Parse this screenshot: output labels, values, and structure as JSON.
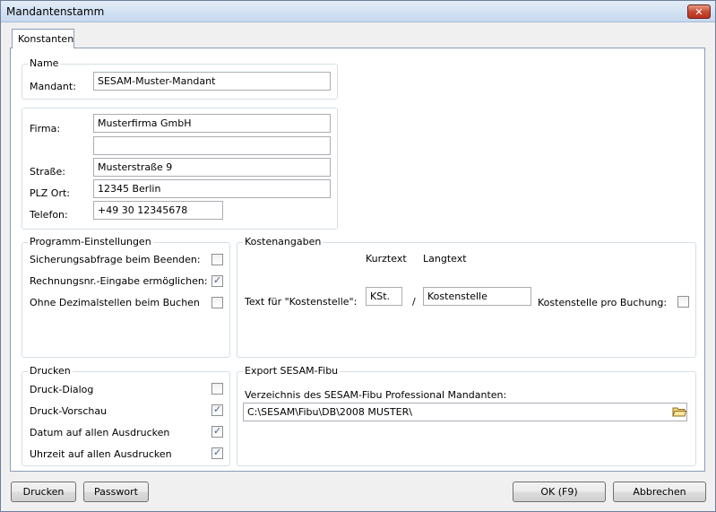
{
  "window": {
    "title": "Mandantenstamm"
  },
  "tabs": [
    {
      "label": "Konstanten"
    }
  ],
  "name_group": {
    "title": "Name",
    "mandant_label": "Mandant:",
    "mandant_value": "SESAM-Muster-Mandant"
  },
  "address_group": {
    "firma_label": "Firma:",
    "firma_value": "Musterfirma GmbH",
    "firma2_value": "",
    "strasse_label": "Straße:",
    "strasse_value": "Musterstraße 9",
    "plzort_label": "PLZ Ort:",
    "plzort_value": "12345 Berlin",
    "telefon_label": "Telefon:",
    "telefon_value": "+49 30 12345678"
  },
  "program_settings": {
    "title": "Programm-Einstellungen",
    "items": [
      {
        "label": "Sicherungsabfrage beim Beenden:",
        "checked": false
      },
      {
        "label": "Rechnungsnr.-Eingabe ermöglichen:",
        "checked": true
      },
      {
        "label": "Ohne Dezimalstellen beim Buchen",
        "checked": false
      }
    ]
  },
  "cost_group": {
    "title": "Kostenangaben",
    "kurztext_header": "Kurztext",
    "langtext_header": "Langtext",
    "row_label": "Text für \"Kostenstelle\":",
    "kurztext_value": "KSt.",
    "separator": "/",
    "langtext_value": "Kostenstelle",
    "pro_buchung_label": "Kostenstelle pro Buchung:",
    "pro_buchung_checked": false
  },
  "print_group": {
    "title": "Drucken",
    "items": [
      {
        "label": "Druck-Dialog",
        "checked": false
      },
      {
        "label": "Druck-Vorschau",
        "checked": true
      },
      {
        "label": "Datum auf allen Ausdrucken",
        "checked": true
      },
      {
        "label": "Uhrzeit auf allen Ausdrucken",
        "checked": true
      }
    ]
  },
  "export_group": {
    "title": "Export SESAM-Fibu",
    "dir_label": "Verzeichnis des SESAM-Fibu Professional Mandanten:",
    "dir_value": "C:\\SESAM\\Fibu\\DB\\2008 MUSTER\\"
  },
  "buttons": {
    "drucken": "Drucken",
    "passwort": "Passwort",
    "ok": "OK (F9)",
    "abbrechen": "Abbrechen"
  },
  "icons": {
    "close": "close-icon",
    "folder": "folder-icon",
    "check": "check-icon"
  }
}
